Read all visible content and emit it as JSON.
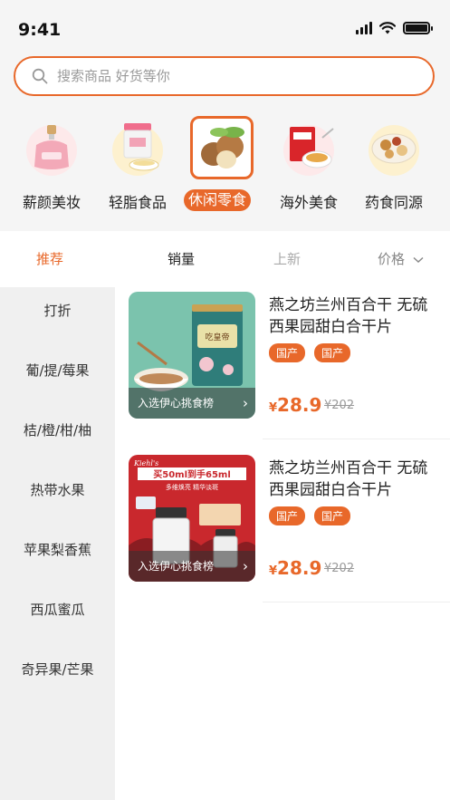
{
  "status": {
    "time": "9:41"
  },
  "search": {
    "placeholder": "搜索商品 好货等你"
  },
  "categories": [
    {
      "label": "薪颜美妆",
      "icon": "perfume-icon"
    },
    {
      "label": "轻脂食品",
      "icon": "protein-jar-icon"
    },
    {
      "label": "休闲零食",
      "icon": "nuts-icon",
      "active": true
    },
    {
      "label": "海外美食",
      "icon": "cereal-box-icon"
    },
    {
      "label": "药食同源",
      "icon": "herbal-bowl-icon"
    }
  ],
  "tabs": [
    {
      "label": "推荐",
      "active": true
    },
    {
      "label": "销量"
    },
    {
      "label": "上新"
    },
    {
      "label": "价格"
    }
  ],
  "sidebar": [
    "打折",
    "葡/提/莓果",
    "桔/橙/柑/柚",
    "热带水果",
    "苹果梨香蕉",
    "西瓜蜜瓜",
    "奇异果/芒果"
  ],
  "products": [
    {
      "title": "燕之坊兰州百合干 无硫西果园甜白合干片",
      "tags": [
        "国产",
        "国产"
      ],
      "price": "28.9",
      "currency": "¥",
      "original_price": "¥202",
      "banner": "入选伊心挑食榜",
      "image_text": {
        "jar_label": "吃皇帝",
        "headline": ""
      }
    },
    {
      "title": "燕之坊兰州百合干 无硫西果园甜白合干片",
      "tags": [
        "国产",
        "国产"
      ],
      "price": "28.9",
      "currency": "¥",
      "original_price": "¥202",
      "banner": "入选伊心挑食榜",
      "image_text": {
        "brand": "Kiehl's",
        "headline": "买50ml到手65ml",
        "sub": "多维焕亮 精华淡斑"
      }
    }
  ],
  "colors": {
    "accent": "#e8682a",
    "sidebar_bg": "#f0f0f0",
    "page_bg": "#f5f5f5"
  }
}
